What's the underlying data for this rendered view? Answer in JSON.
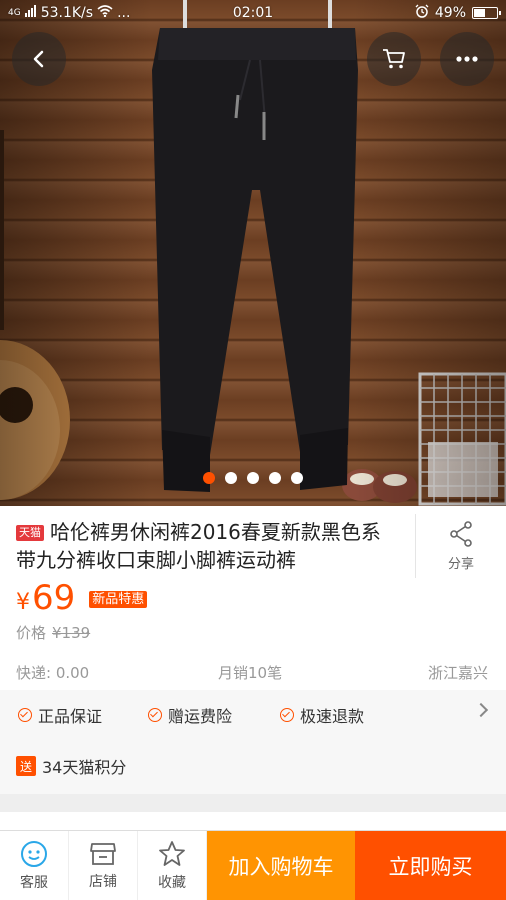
{
  "status_bar": {
    "signal": "4G",
    "speed": "53.1K/s",
    "dots": "...",
    "time": "02:01",
    "battery": "49%",
    "battery_level": 0.49
  },
  "gallery": {
    "dot_count": 5,
    "active_index": 0
  },
  "product": {
    "badge": "天猫",
    "title": "哈伦裤男休闲裤2016春夏新款黑色系带九分裤收口束脚小脚裤运动裤",
    "share_label": "分享",
    "currency": "¥",
    "price": "69",
    "promo_tag": "新品特惠",
    "orig_price_label": "价格",
    "orig_price": "¥139",
    "shipping": "快递: 0.00",
    "monthly_sales": "月销10笔",
    "location": "浙江嘉兴"
  },
  "guarantees": [
    "正品保证",
    "赠运费险",
    "极速退款"
  ],
  "points": {
    "badge": "送",
    "text": "34天猫积分"
  },
  "bottom_bar": {
    "service": "客服",
    "shop": "店铺",
    "favorite": "收藏",
    "add_to_cart": "加入购物车",
    "buy_now": "立即购买"
  },
  "colors": {
    "accent": "#ff5000",
    "cart_button": "#ff9402",
    "tmall_red": "#e4393c",
    "service_icon": "#2aa7e8"
  }
}
